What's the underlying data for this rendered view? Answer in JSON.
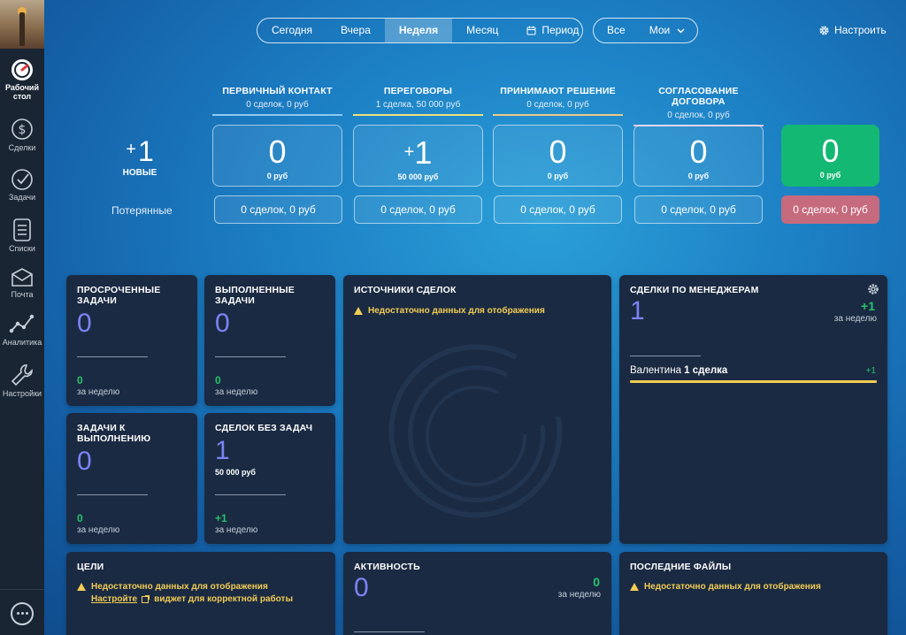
{
  "sidebar": {
    "items": [
      {
        "label": "Рабочий стол",
        "icon": "dashboard-icon"
      },
      {
        "label": "Сделки",
        "icon": "dollar-icon"
      },
      {
        "label": "Задачи",
        "icon": "tasks-icon"
      },
      {
        "label": "Списки",
        "icon": "lists-icon"
      },
      {
        "label": "Почта",
        "icon": "mail-icon"
      },
      {
        "label": "Аналитика",
        "icon": "analytics-icon"
      },
      {
        "label": "Настройки",
        "icon": "settings-icon"
      }
    ]
  },
  "period_tabs": [
    "Сегодня",
    "Вчера",
    "Неделя",
    "Месяц",
    "Период"
  ],
  "period_active": "Неделя",
  "scope_tabs": {
    "all": "Все",
    "mine": "Мои"
  },
  "settings_label": "Настроить",
  "new_deals": {
    "value": "+1",
    "label": "НОВЫЕ"
  },
  "lost_label": "Потерянные",
  "stages": [
    {
      "title": "ПЕРВИЧНЫЙ КОНТАКТ",
      "summary": "0 сделок, 0 руб",
      "value": "0",
      "sum": "0 руб",
      "lost": "0 сделок, 0 руб",
      "color": "#8ec9f2"
    },
    {
      "title": "ПЕРЕГОВОРЫ",
      "summary": "1 сделка, 50 000 руб",
      "value": "+1",
      "sum": "50 000 руб",
      "lost": "0 сделок, 0 руб",
      "color": "#f1e27a"
    },
    {
      "title": "ПРИНИМАЮТ РЕШЕНИЕ",
      "summary": "0 сделок, 0 руб",
      "value": "0",
      "sum": "0 руб",
      "lost": "0 сделок, 0 руб",
      "color": "#f1c987"
    },
    {
      "title": "СОГЛАСОВАНИЕ ДОГОВОРА",
      "summary": "0 сделок, 0 руб",
      "value": "0",
      "sum": "0 руб",
      "lost": "0 сделок, 0 руб",
      "color": "#e3c3d8"
    }
  ],
  "won": {
    "value": "0",
    "sum": "0 руб"
  },
  "lost_total": "0 сделок, 0 руб",
  "widgets": {
    "overdue": {
      "title1": "ПРОСРОЧЕННЫЕ",
      "title2": "ЗАДАЧИ",
      "value": "0",
      "delta": "0",
      "period": "за неделю"
    },
    "done": {
      "title1": "ВЫПОЛНЕННЫЕ",
      "title2": "ЗАДАЧИ",
      "value": "0",
      "delta": "0",
      "period": "за неделю"
    },
    "todo": {
      "title1": "ЗАДАЧИ К",
      "title2": "ВЫПОЛНЕНИЮ",
      "value": "0",
      "delta": "0",
      "period": "за неделю"
    },
    "no_tasks": {
      "title": "СДЕЛОК БЕЗ ЗАДАЧ",
      "value": "1",
      "sum": "50 000 руб",
      "delta": "+1",
      "period": "за неделю"
    },
    "sources": {
      "title": "ИСТОЧНИКИ СДЕЛОК",
      "warning": "Недостаточно данных для отображения"
    },
    "managers": {
      "title": "СДЕЛКИ ПО МЕНЕДЖЕРАМ",
      "value": "1",
      "delta": "+1",
      "period": "за неделю",
      "row_name": "Валентина",
      "row_deals": "1 сделка",
      "row_delta": "+1"
    },
    "goals": {
      "title": "ЦЕЛИ",
      "warning": "Недостаточно данных для отображения",
      "link": "Настройте",
      "rest": "виджет для корректной работы"
    },
    "activity": {
      "title": "АКТИВНОСТЬ",
      "value": "0",
      "delta": "0",
      "period": "за неделю"
    },
    "files": {
      "title": "ПОСЛЕДНИЕ ФАЙЛЫ",
      "warning": "Недостаточно данных для отображения"
    }
  }
}
